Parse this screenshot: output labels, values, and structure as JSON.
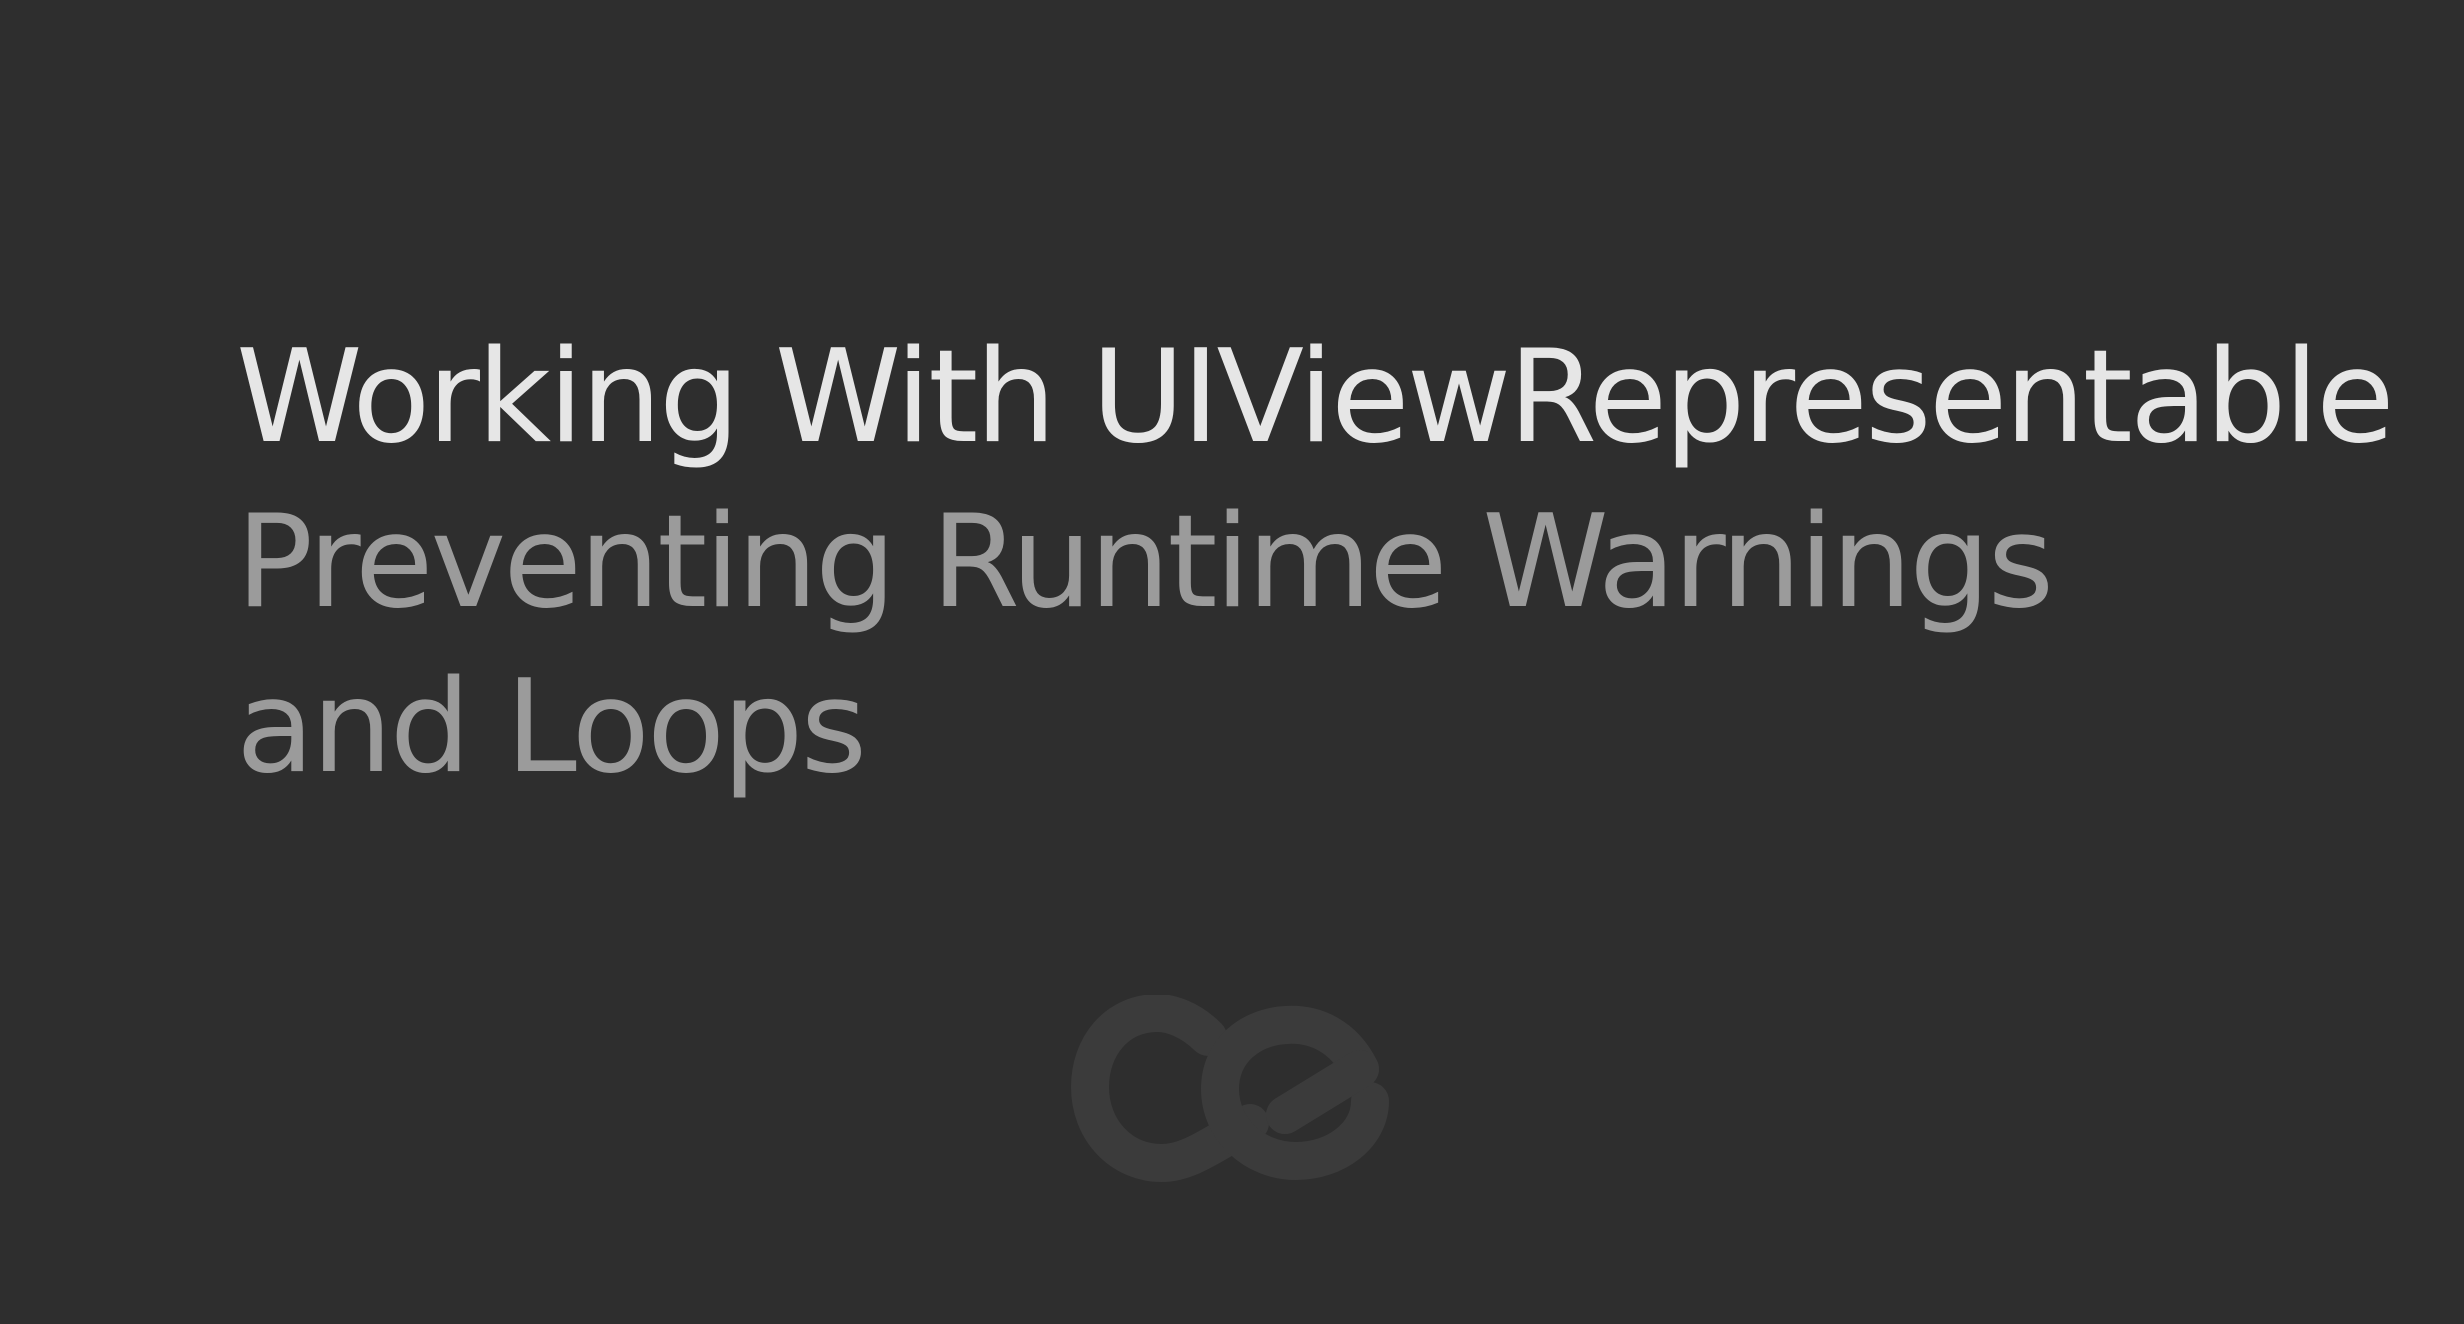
{
  "slide": {
    "title": "Working With UIViewRepresentable",
    "subtitle_line1": "Preventing Runtime Warnings",
    "subtitle_line2": "and Loops"
  },
  "logo": {
    "icon": "ce-logo-icon",
    "text": "ce"
  },
  "colors": {
    "background": "#2e2e2e",
    "title": "#e6e6e6",
    "subtitle": "#9b9b9b",
    "logo": "#3b3b3b"
  }
}
